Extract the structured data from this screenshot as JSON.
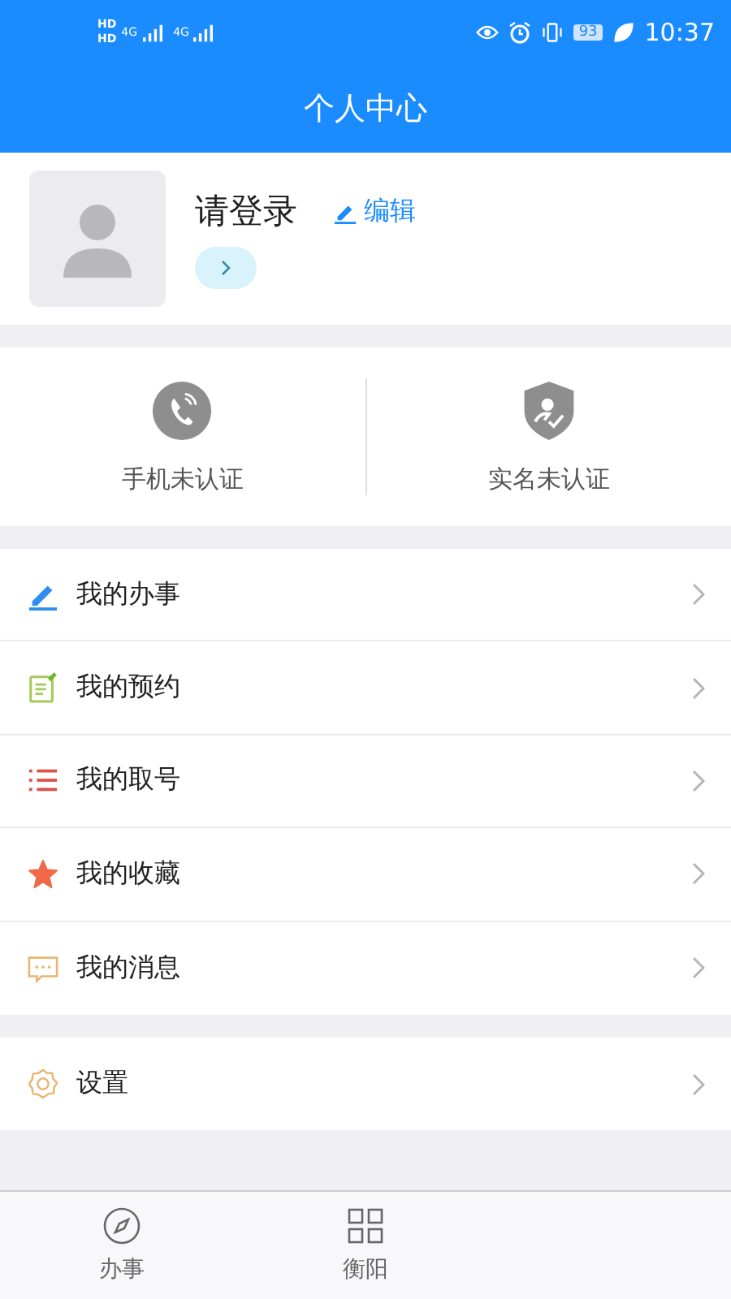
{
  "status_bar": {
    "sim_labels": [
      "HD",
      "HD"
    ],
    "network_labels": [
      "4G",
      "4G"
    ],
    "battery": "93",
    "time": "10:37"
  },
  "header": {
    "title": "个人中心"
  },
  "profile": {
    "name": "请登录",
    "edit_label": "编辑"
  },
  "verification": [
    {
      "kind": "phone",
      "label": "手机未认证"
    },
    {
      "kind": "identity",
      "label": "实名未认证"
    }
  ],
  "menu": [
    {
      "kind": "tasks",
      "label": "我的办事"
    },
    {
      "kind": "appointment",
      "label": "我的预约"
    },
    {
      "kind": "queue",
      "label": "我的取号"
    },
    {
      "kind": "favorites",
      "label": "我的收藏"
    },
    {
      "kind": "messages",
      "label": "我的消息"
    }
  ],
  "settings": [
    {
      "kind": "settings",
      "label": "设置"
    }
  ],
  "tab_bar": [
    {
      "kind": "compass",
      "label": "办事",
      "selected": false
    },
    {
      "kind": "grid",
      "label": "衡阳",
      "selected": false
    }
  ]
}
